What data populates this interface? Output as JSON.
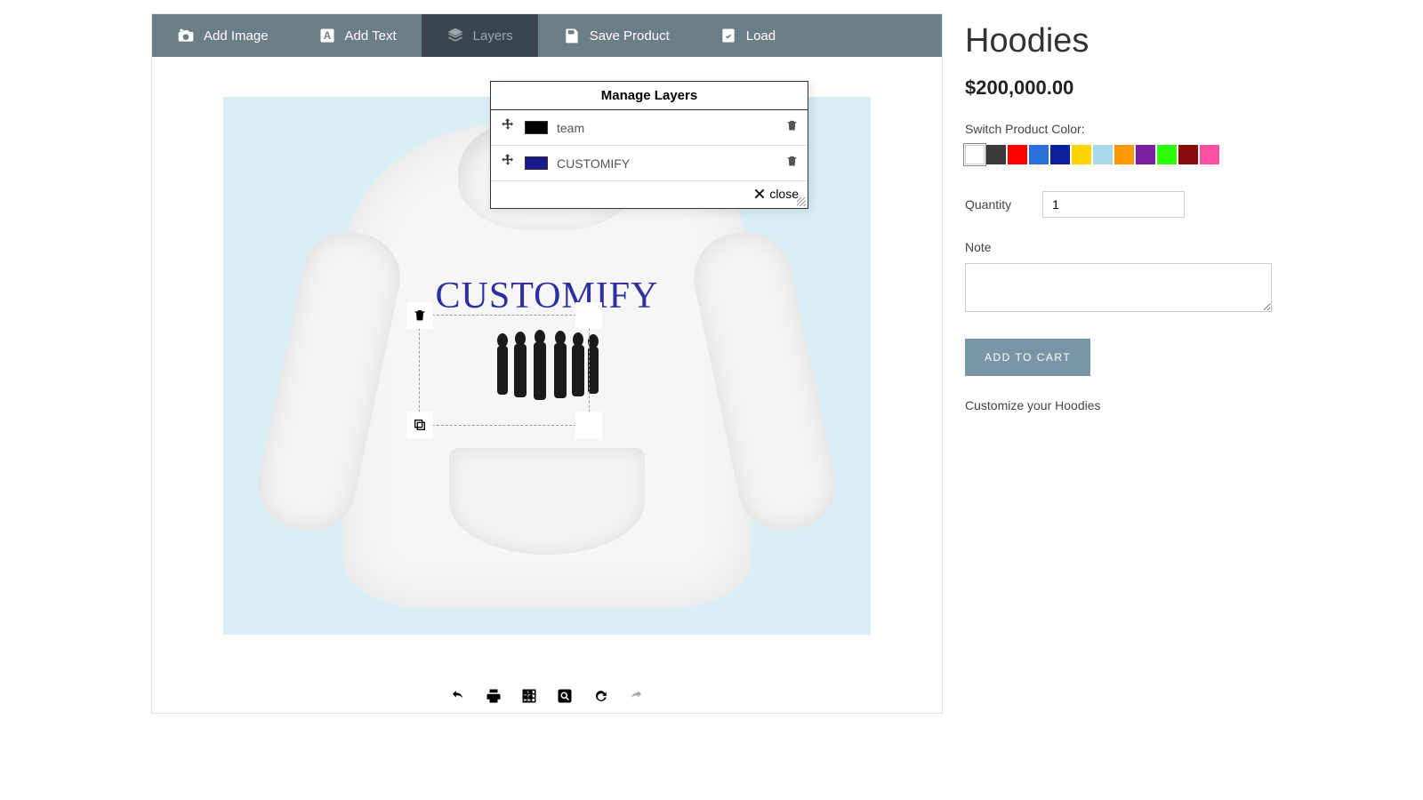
{
  "toolbar": {
    "add_image": "Add Image",
    "add_text": "Add Text",
    "layers": "Layers",
    "save_product": "Save Product",
    "load": "Load"
  },
  "layers_panel": {
    "title": "Manage Layers",
    "close": "close",
    "items": [
      {
        "name": "team",
        "color": "#000000"
      },
      {
        "name": "CUSTOMIFY",
        "color": "#18188f"
      }
    ]
  },
  "canvas": {
    "text_overlay": "CUSTOMIFY"
  },
  "product": {
    "title": "Hoodies",
    "price": "$200,000.00",
    "switch_label": "Switch Product Color:",
    "colors": [
      "#ffffff",
      "#3a3a3a",
      "#ff0000",
      "#2c6fdb",
      "#0a1f9c",
      "#ffd400",
      "#a9d9e8",
      "#ff9900",
      "#7a1fa2",
      "#2cff05",
      "#8a0b0b",
      "#ff4fa3"
    ],
    "selected_color_index": 0,
    "qty_label": "Quantity",
    "qty_value": "1",
    "note_label": "Note",
    "add_to_cart": "ADD TO CART",
    "description": "Customize your Hoodies"
  }
}
